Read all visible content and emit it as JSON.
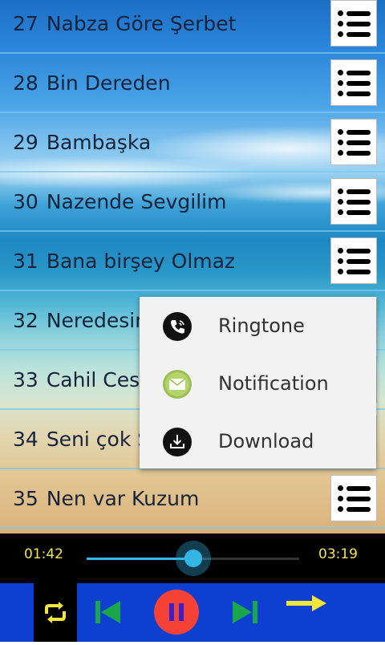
{
  "songs": [
    {
      "num": "27",
      "title": "Nabza Göre Şerbet"
    },
    {
      "num": "28",
      "title": "Bin Dereden"
    },
    {
      "num": "29",
      "title": "Bambaşka"
    },
    {
      "num": "30",
      "title": "Nazende Sevgilim"
    },
    {
      "num": "31",
      "title": "Bana birşey Olmaz"
    },
    {
      "num": "32",
      "title": "Neredesin"
    },
    {
      "num": "33",
      "title": "Cahil Ces"
    },
    {
      "num": "34",
      "title": "Seni çok S"
    },
    {
      "num": "35",
      "title": "Nen var Kuzum"
    }
  ],
  "popup": {
    "items": [
      {
        "label": "Ringtone",
        "icon": "phone-icon"
      },
      {
        "label": "Notification",
        "icon": "envelope-icon"
      },
      {
        "label": "Download",
        "icon": "download-icon"
      }
    ]
  },
  "player": {
    "elapsed": "01:42",
    "duration": "03:19",
    "progress": 0.5
  },
  "colors": {
    "time_text": "#f3e64a",
    "accent": "#33b5e5",
    "controls_bg": "#0d3fd0",
    "pause_button": "#f44336",
    "transport_icons": "#1aa64a",
    "repeat_icon": "#f5e63a"
  },
  "icons": {
    "menu": "list-menu-icon",
    "repeat": "repeat-icon",
    "previous": "skip-previous-icon",
    "pause": "pause-icon",
    "next": "skip-next-icon",
    "shuffle": "arrow-right-icon"
  }
}
